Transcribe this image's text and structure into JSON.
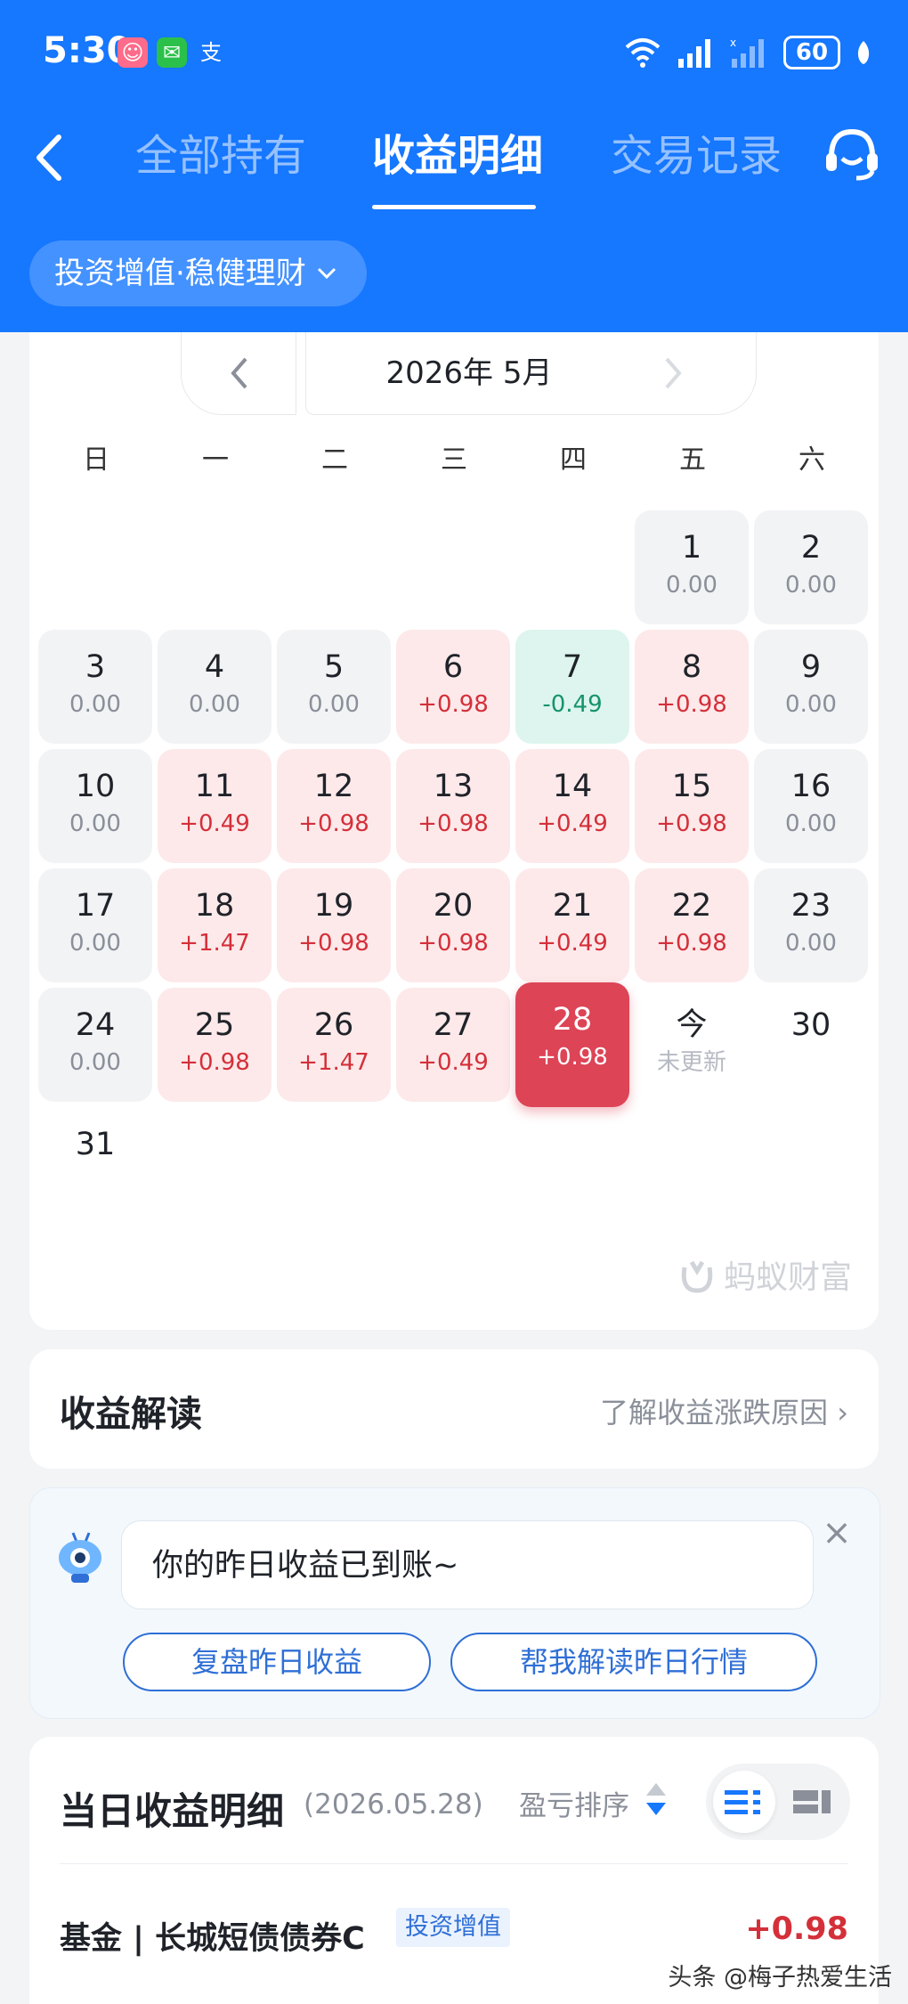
{
  "status_bar": {
    "time": "5:30",
    "battery": "60"
  },
  "nav": {
    "tabs": [
      {
        "label": "全部持有",
        "active": false
      },
      {
        "label": "收益明细",
        "active": true
      },
      {
        "label": "交易记录",
        "active": false
      }
    ]
  },
  "product_selector": {
    "label": "投资增值·稳健理财"
  },
  "calendar": {
    "month_label": "2026年 5月",
    "weekdays": [
      "日",
      "一",
      "二",
      "三",
      "四",
      "五",
      "六"
    ],
    "days": [
      {
        "d": "1",
        "v": "0.00",
        "kind": "zero"
      },
      {
        "d": "2",
        "v": "0.00",
        "kind": "zero"
      },
      {
        "d": "3",
        "v": "0.00",
        "kind": "zero"
      },
      {
        "d": "4",
        "v": "0.00",
        "kind": "zero"
      },
      {
        "d": "5",
        "v": "0.00",
        "kind": "zero"
      },
      {
        "d": "6",
        "v": "+0.98",
        "kind": "pos"
      },
      {
        "d": "7",
        "v": "-0.49",
        "kind": "neg"
      },
      {
        "d": "8",
        "v": "+0.98",
        "kind": "pos"
      },
      {
        "d": "9",
        "v": "0.00",
        "kind": "zero"
      },
      {
        "d": "10",
        "v": "0.00",
        "kind": "zero"
      },
      {
        "d": "11",
        "v": "+0.49",
        "kind": "pos"
      },
      {
        "d": "12",
        "v": "+0.98",
        "kind": "pos"
      },
      {
        "d": "13",
        "v": "+0.98",
        "kind": "pos"
      },
      {
        "d": "14",
        "v": "+0.49",
        "kind": "pos"
      },
      {
        "d": "15",
        "v": "+0.98",
        "kind": "pos"
      },
      {
        "d": "16",
        "v": "0.00",
        "kind": "zero"
      },
      {
        "d": "17",
        "v": "0.00",
        "kind": "zero"
      },
      {
        "d": "18",
        "v": "+1.47",
        "kind": "pos"
      },
      {
        "d": "19",
        "v": "+0.98",
        "kind": "pos"
      },
      {
        "d": "20",
        "v": "+0.98",
        "kind": "pos"
      },
      {
        "d": "21",
        "v": "+0.49",
        "kind": "pos"
      },
      {
        "d": "22",
        "v": "+0.98",
        "kind": "pos"
      },
      {
        "d": "23",
        "v": "0.00",
        "kind": "zero"
      },
      {
        "d": "24",
        "v": "0.00",
        "kind": "zero"
      },
      {
        "d": "25",
        "v": "+0.98",
        "kind": "pos"
      },
      {
        "d": "26",
        "v": "+1.47",
        "kind": "pos"
      },
      {
        "d": "27",
        "v": "+0.49",
        "kind": "pos"
      },
      {
        "d": "28",
        "v": "+0.98",
        "kind": "sel"
      },
      {
        "d": "今",
        "v": "未更新",
        "kind": "today"
      },
      {
        "d": "30",
        "v": "",
        "kind": "plain"
      },
      {
        "d": "31",
        "v": "",
        "kind": "plain"
      }
    ],
    "watermark": "蚂蚁财富"
  },
  "insight": {
    "title": "收益解读",
    "link": "了解收益涨跌原因"
  },
  "assistant": {
    "message": "你的昨日收益已到账~",
    "buttons": [
      "复盘昨日收益",
      "帮我解读昨日行情"
    ]
  },
  "detail": {
    "title": "当日收益明细",
    "date": "(2026.05.28)",
    "sort_label": "盈亏排序",
    "rows": [
      {
        "name": "基金 | 长城短债债券C",
        "tag": "投资增值",
        "amount": "+0.98"
      }
    ]
  },
  "watermark2": "头条 @梅子热爱生活",
  "colors": {
    "brand": "#1677ff",
    "gain": "#d4303a",
    "loss": "#16946a",
    "selected": "#dd4456"
  }
}
